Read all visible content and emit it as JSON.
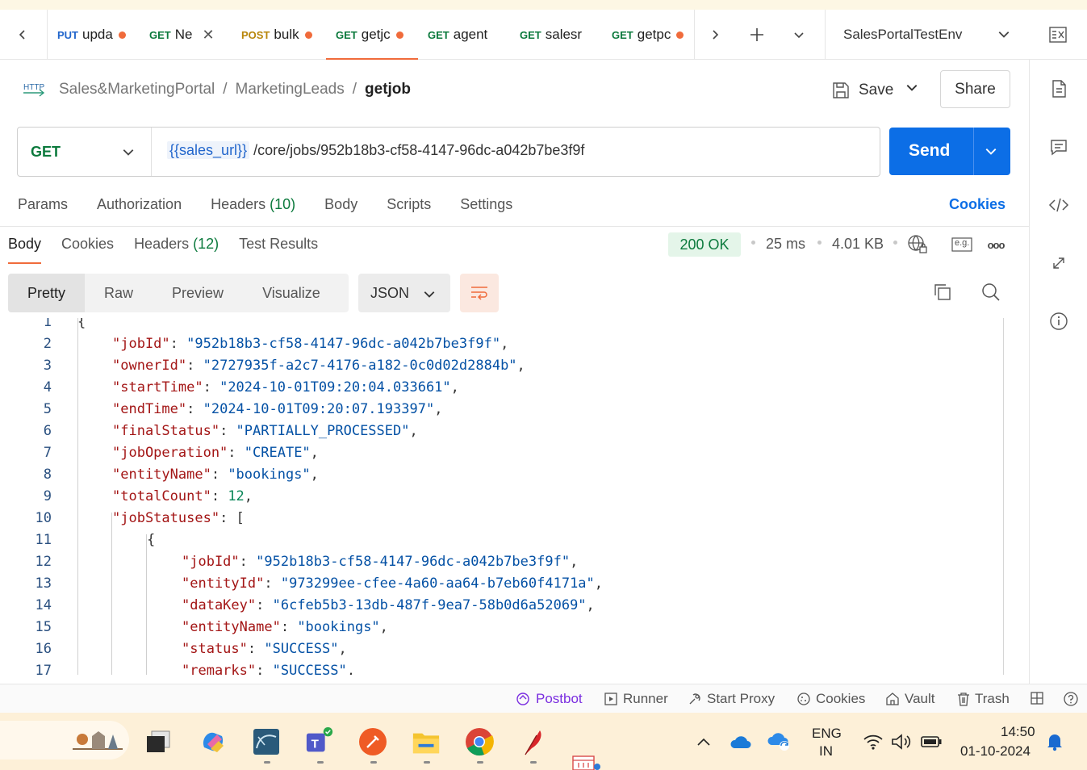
{
  "tabs": [
    {
      "method": "PUT",
      "name": "upda",
      "dirty": true
    },
    {
      "method": "GET",
      "name": "Ne",
      "close": "✕"
    },
    {
      "method": "POST",
      "name": "bulk",
      "dirty": true
    },
    {
      "method": "GET",
      "name": "getjc",
      "dirty": true,
      "active": true
    },
    {
      "method": "GET",
      "name": "agent"
    },
    {
      "method": "GET",
      "name": "salesr"
    },
    {
      "method": "GET",
      "name": "getpc",
      "dirty": true
    }
  ],
  "environment": "SalesPortalTestEnv",
  "breadcrumb": {
    "collection": "Sales&MarketingPortal",
    "folder": "MarketingLeads",
    "request": "getjob",
    "sep": "/"
  },
  "actions": {
    "save": "Save",
    "share": "Share",
    "send": "Send"
  },
  "request": {
    "method": "GET",
    "url_var": "{{sales_url}}",
    "url_path": "/core/jobs/952b18b3-cf58-4147-96dc-a042b7be3f9f"
  },
  "request_tabs": {
    "params": "Params",
    "authorization": "Authorization",
    "headers": "Headers",
    "headers_count": "(10)",
    "body": "Body",
    "scripts": "Scripts",
    "settings": "Settings",
    "cookies": "Cookies"
  },
  "response_tabs": {
    "body": "Body",
    "cookies": "Cookies",
    "headers": "Headers",
    "headers_count": "(12)",
    "test_results": "Test Results"
  },
  "response_meta": {
    "status": "200 OK",
    "time": "25 ms",
    "size": "4.01 KB",
    "example_label": "e.g.",
    "more": "ooo"
  },
  "views": {
    "pretty": "Pretty",
    "raw": "Raw",
    "preview": "Preview",
    "visualize": "Visualize",
    "format": "JSON"
  },
  "code_lines": [
    {
      "n": "1",
      "indent": 0,
      "parts": [
        [
          "p",
          "{"
        ]
      ]
    },
    {
      "n": "2",
      "indent": 1,
      "parts": [
        [
          "k",
          "\"jobId\""
        ],
        [
          "p",
          ": "
        ],
        [
          "s",
          "\"952b18b3-cf58-4147-96dc-a042b7be3f9f\""
        ],
        [
          "p",
          ","
        ]
      ]
    },
    {
      "n": "3",
      "indent": 1,
      "parts": [
        [
          "k",
          "\"ownerId\""
        ],
        [
          "p",
          ": "
        ],
        [
          "s",
          "\"2727935f-a2c7-4176-a182-0c0d02d2884b\""
        ],
        [
          "p",
          ","
        ]
      ]
    },
    {
      "n": "4",
      "indent": 1,
      "parts": [
        [
          "k",
          "\"startTime\""
        ],
        [
          "p",
          ": "
        ],
        [
          "s",
          "\"2024-10-01T09:20:04.033661\""
        ],
        [
          "p",
          ","
        ]
      ]
    },
    {
      "n": "5",
      "indent": 1,
      "parts": [
        [
          "k",
          "\"endTime\""
        ],
        [
          "p",
          ": "
        ],
        [
          "s",
          "\"2024-10-01T09:20:07.193397\""
        ],
        [
          "p",
          ","
        ]
      ]
    },
    {
      "n": "6",
      "indent": 1,
      "parts": [
        [
          "k",
          "\"finalStatus\""
        ],
        [
          "p",
          ": "
        ],
        [
          "s",
          "\"PARTIALLY_PROCESSED\""
        ],
        [
          "p",
          ","
        ]
      ]
    },
    {
      "n": "7",
      "indent": 1,
      "parts": [
        [
          "k",
          "\"jobOperation\""
        ],
        [
          "p",
          ": "
        ],
        [
          "s",
          "\"CREATE\""
        ],
        [
          "p",
          ","
        ]
      ]
    },
    {
      "n": "8",
      "indent": 1,
      "parts": [
        [
          "k",
          "\"entityName\""
        ],
        [
          "p",
          ": "
        ],
        [
          "s",
          "\"bookings\""
        ],
        [
          "p",
          ","
        ]
      ]
    },
    {
      "n": "9",
      "indent": 1,
      "parts": [
        [
          "k",
          "\"totalCount\""
        ],
        [
          "p",
          ": "
        ],
        [
          "num",
          "12"
        ],
        [
          "p",
          ","
        ]
      ]
    },
    {
      "n": "10",
      "indent": 1,
      "parts": [
        [
          "k",
          "\"jobStatuses\""
        ],
        [
          "p",
          ": ["
        ]
      ]
    },
    {
      "n": "11",
      "indent": 2,
      "parts": [
        [
          "p",
          "{"
        ]
      ]
    },
    {
      "n": "12",
      "indent": 3,
      "parts": [
        [
          "k",
          "\"jobId\""
        ],
        [
          "p",
          ": "
        ],
        [
          "s",
          "\"952b18b3-cf58-4147-96dc-a042b7be3f9f\""
        ],
        [
          "p",
          ","
        ]
      ]
    },
    {
      "n": "13",
      "indent": 3,
      "parts": [
        [
          "k",
          "\"entityId\""
        ],
        [
          "p",
          ": "
        ],
        [
          "s",
          "\"973299ee-cfee-4a60-aa64-b7eb60f4171a\""
        ],
        [
          "p",
          ","
        ]
      ]
    },
    {
      "n": "14",
      "indent": 3,
      "parts": [
        [
          "k",
          "\"dataKey\""
        ],
        [
          "p",
          ": "
        ],
        [
          "s",
          "\"6cfeb5b3-13db-487f-9ea7-58b0d6a52069\""
        ],
        [
          "p",
          ","
        ]
      ]
    },
    {
      "n": "15",
      "indent": 3,
      "parts": [
        [
          "k",
          "\"entityName\""
        ],
        [
          "p",
          ": "
        ],
        [
          "s",
          "\"bookings\""
        ],
        [
          "p",
          ","
        ]
      ]
    },
    {
      "n": "16",
      "indent": 3,
      "parts": [
        [
          "k",
          "\"status\""
        ],
        [
          "p",
          ": "
        ],
        [
          "s",
          "\"SUCCESS\""
        ],
        [
          "p",
          ","
        ]
      ]
    },
    {
      "n": "17",
      "indent": 3,
      "parts": [
        [
          "k",
          "\"remarks\""
        ],
        [
          "p",
          ": "
        ],
        [
          "s",
          "\"SUCCESS\""
        ],
        [
          "p",
          ","
        ]
      ]
    }
  ],
  "statusbar": {
    "postbot": "Postbot",
    "runner": "Runner",
    "start_proxy": "Start Proxy",
    "cookies": "Cookies",
    "vault": "Vault",
    "trash": "Trash"
  },
  "system_tray": {
    "lang1": "ENG",
    "lang2": "IN",
    "time": "14:50",
    "date": "01-10-2024"
  },
  "colors": {
    "accent": "#f06b3b",
    "send": "#0c6ee6",
    "get": "#0c7a3d",
    "put": "#2266cc",
    "post": "#b8860b",
    "string": "#0451a5",
    "key": "#a31515",
    "number": "#098658"
  }
}
